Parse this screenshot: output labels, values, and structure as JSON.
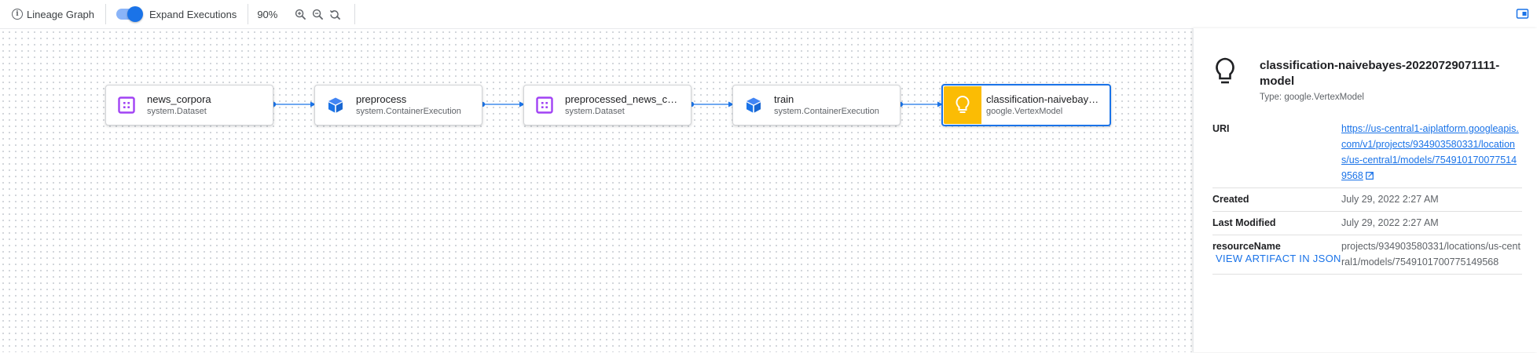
{
  "toolbar": {
    "lineage_label": "Lineage Graph",
    "expand_label": "Expand Executions",
    "expand_on": true,
    "zoom_level": "90%"
  },
  "nodes": [
    {
      "title": "news_corpora",
      "type": "system.Dataset",
      "icon": "dataset-icon"
    },
    {
      "title": "preprocess",
      "type": "system.ContainerExecution",
      "icon": "cube-icon"
    },
    {
      "title": "preprocessed_news_corpora",
      "type": "system.Dataset",
      "icon": "dataset-icon"
    },
    {
      "title": "train",
      "type": "system.ContainerExecution",
      "icon": "cube-icon"
    },
    {
      "title": "classification-naivebayes-20220729071111-model",
      "type": "google.VertexModel",
      "icon": "lightbulb-icon",
      "selected": true
    }
  ],
  "panel": {
    "title": "classification-naivebayes-20220729071111-model",
    "type_text": "Type: google.VertexModel",
    "rows": [
      {
        "key": "URI",
        "value": "https://us-central1-aiplatform.googleapis.com/v1/projects/934903580331/locations/us-central1/models/7549101700775149568",
        "is_link": true
      },
      {
        "key": "Created",
        "value": "July 29, 2022 2:27 AM"
      },
      {
        "key": "Last Modified",
        "value": "July 29, 2022 2:27 AM"
      },
      {
        "key": "resourceName",
        "value": "projects/934903580331/locations/us-central1/models/7549101700775149568"
      }
    ],
    "view_json_label": "VIEW ARTIFACT IN JSON"
  },
  "colors": {
    "accent": "#1a73e8",
    "dataset_icon": "#a142f4",
    "execution_icon": "#1a73e8",
    "model_bg": "#fbbc04"
  }
}
